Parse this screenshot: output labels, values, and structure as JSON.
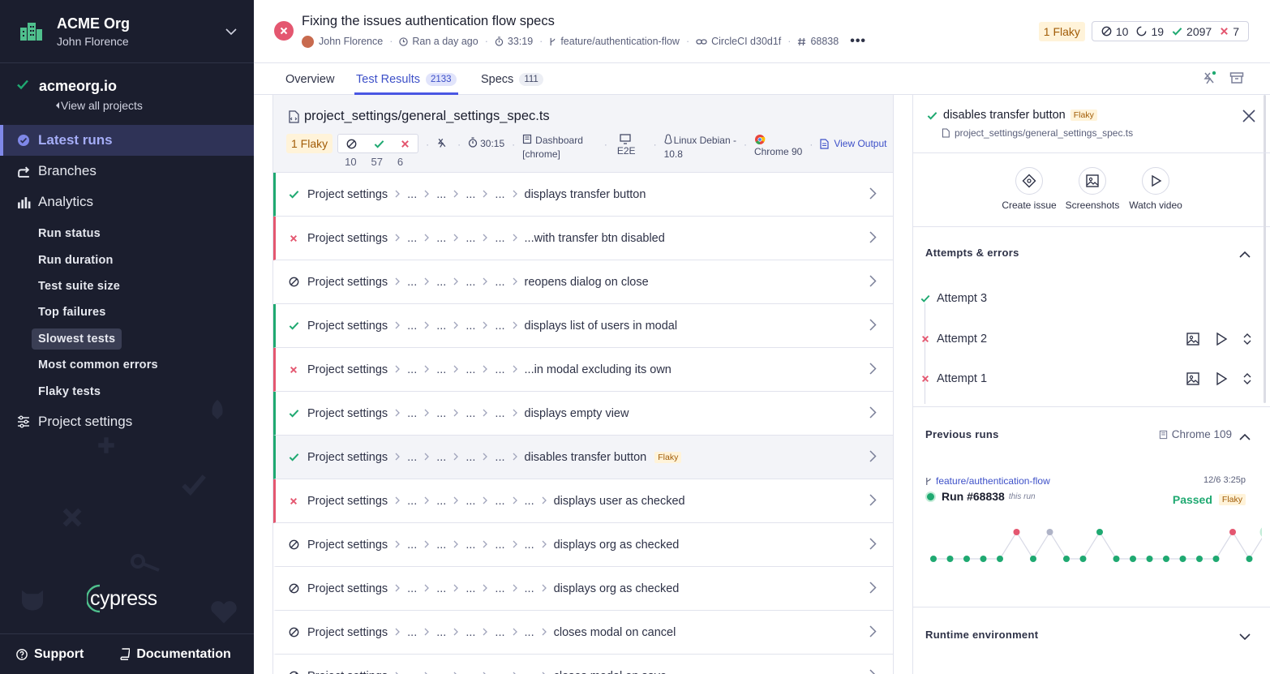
{
  "sidebar": {
    "org_name": "ACME Org",
    "org_user": "John Florence",
    "project_name": "acmeorg.io",
    "view_all": "View all projects",
    "nav": [
      {
        "label": "Latest runs",
        "icon": "check-circle-icon"
      },
      {
        "label": "Branches",
        "icon": "branch-icon"
      },
      {
        "label": "Analytics",
        "icon": "bar-chart-icon"
      }
    ],
    "analytics_items": [
      "Run status",
      "Run duration",
      "Test suite size",
      "Top failures",
      "Slowest tests",
      "Most common errors",
      "Flaky tests"
    ],
    "project_settings": "Project settings",
    "logo_text": "cypress",
    "support": "Support",
    "documentation": "Documentation"
  },
  "header": {
    "title": "Fixing the issues authentication flow specs",
    "author": "John Florence",
    "ran": "Ran a day ago",
    "duration": "33:19",
    "branch": "feature/authentication-flow",
    "ci": "CircleCI d30d1f",
    "run_number": "68838",
    "flaky": "1 Flaky",
    "skipped": "10",
    "pending": "19",
    "passed": "2097",
    "failed": "7"
  },
  "tabs": [
    {
      "label": "Overview"
    },
    {
      "label": "Test Results",
      "count": "2133"
    },
    {
      "label": "Specs",
      "count": "111"
    }
  ],
  "spec": {
    "name": "project_settings/general_settings_spec.ts",
    "flaky": "1 Flaky",
    "skipped": "10",
    "passed": "57",
    "failed": "6",
    "duration": "30:15",
    "group_line1": "Dashboard",
    "group_line2": "[chrome]",
    "type": "E2E",
    "os_line1": "Linux Debian -",
    "os_line2": "10.8",
    "browser": "Chrome 90",
    "view_output": "View Output"
  },
  "tests": [
    {
      "status": "passed",
      "crumb": "Project settings",
      "title": "displays transfer button",
      "depth": 4
    },
    {
      "status": "failed",
      "crumb": "Project settings",
      "title": "...with transfer btn disabled",
      "depth": 4
    },
    {
      "status": "skipped",
      "crumb": "Project settings",
      "title": "reopens dialog on close",
      "depth": 4
    },
    {
      "status": "passed",
      "crumb": "Project settings",
      "title": "displays list of users in modal",
      "depth": 4
    },
    {
      "status": "failed",
      "crumb": "Project settings",
      "title": "...in modal excluding its own",
      "depth": 4
    },
    {
      "status": "passed",
      "crumb": "Project settings",
      "title": "displays empty view",
      "depth": 4
    },
    {
      "status": "passed",
      "crumb": "Project settings",
      "title": "disables transfer button",
      "depth": 4,
      "flaky": "Flaky",
      "selected": true
    },
    {
      "status": "failed",
      "crumb": "Project settings",
      "title": "displays user as checked",
      "depth": 5
    },
    {
      "status": "skipped",
      "crumb": "Project settings",
      "title": "displays org as checked",
      "depth": 5
    },
    {
      "status": "skipped",
      "crumb": "Project settings",
      "title": "displays org as checked",
      "depth": 5
    },
    {
      "status": "skipped",
      "crumb": "Project settings",
      "title": "closes modal on cancel",
      "depth": 5
    },
    {
      "status": "skipped",
      "crumb": "Project settings",
      "title": "closes modal on save",
      "depth": 5
    }
  ],
  "detail": {
    "title": "disables transfer button",
    "flaky": "Flaky",
    "path": "project_settings/general_settings_spec.ts",
    "actions": [
      "Create issue",
      "Screenshots",
      "Watch video"
    ],
    "attempts_title": "Attempts & errors",
    "attempts": [
      {
        "label": "Attempt 3",
        "status": "passed"
      },
      {
        "label": "Attempt 2",
        "status": "failed"
      },
      {
        "label": "Attempt 1",
        "status": "failed"
      }
    ],
    "previous_title": "Previous runs",
    "previous_browser": "Chrome 109",
    "run_branch": "feature/authentication-flow",
    "run_date": "12/6 3:25p",
    "run_label": "Run #68838",
    "this_run": "this run",
    "run_status": "Passed",
    "run_flaky": "Flaky",
    "runtime_title": "Runtime environment"
  },
  "colors": {
    "pass": "#1fa971",
    "fail": "#e45770",
    "accent": "#4956e3",
    "sidebar": "#1b1e2e",
    "flaky_bg": "#fff3d9"
  }
}
